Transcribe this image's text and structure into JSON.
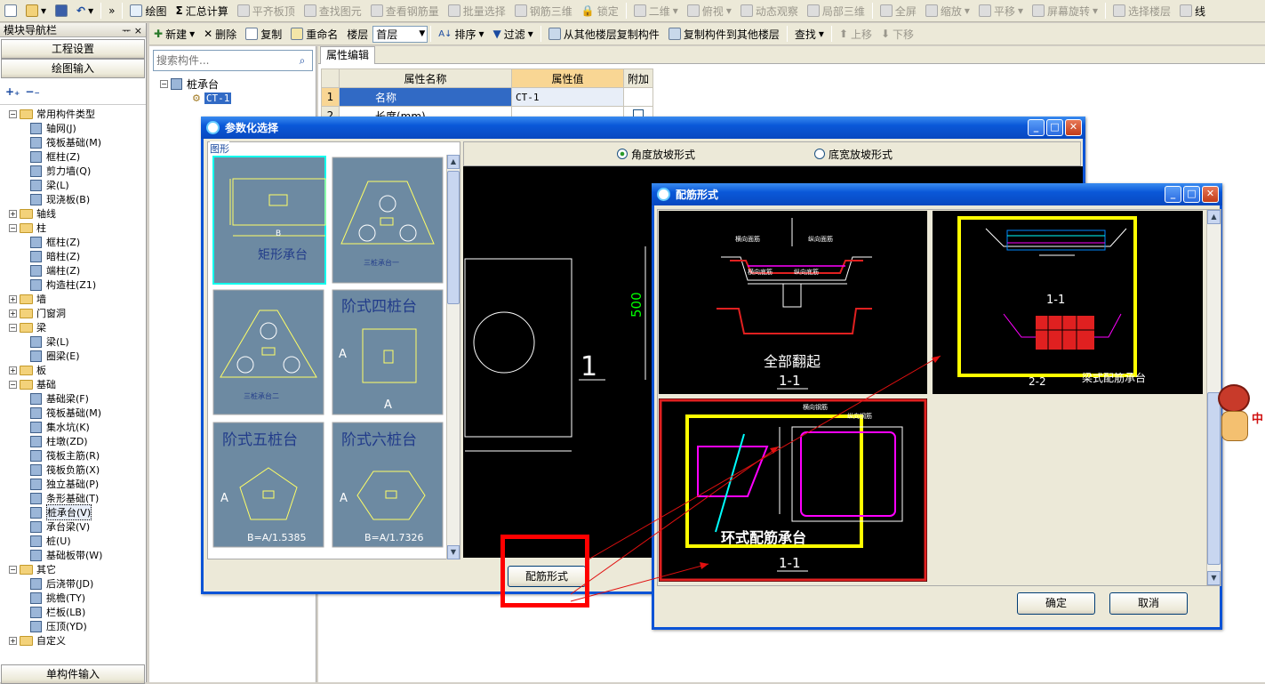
{
  "toolbar1": {
    "items": [
      "绘图",
      "汇总计算",
      "平齐板顶",
      "查找图元",
      "查看钢筋量",
      "批量选择",
      "钢筋三维",
      "锁定",
      "二维",
      "俯视",
      "动态观察",
      "局部三维",
      "全屏",
      "缩放",
      "平移",
      "屏幕旋转",
      "选择楼层",
      "线"
    ]
  },
  "toolbar2": {
    "new": "新建",
    "delete": "删除",
    "copy": "复制",
    "rename": "重命名",
    "floor_label": "楼层",
    "floor_value": "首层",
    "sort": "排序",
    "filter": "过滤",
    "copy_from": "从其他楼层复制构件",
    "copy_to": "复制构件到其他楼层",
    "find": "查找",
    "up": "上移",
    "down": "下移"
  },
  "nav": {
    "title": "模块导航栏",
    "pin": "ᅲ ×",
    "project_settings": "工程设置",
    "drawing_input": "绘图输入",
    "single_input": "单构件输入",
    "tree": [
      {
        "label": "常用构件类型",
        "level": 0,
        "type": "folder",
        "expanded": true
      },
      {
        "label": "轴网(J)",
        "level": 1
      },
      {
        "label": "筏板基础(M)",
        "level": 1
      },
      {
        "label": "框柱(Z)",
        "level": 1
      },
      {
        "label": "剪力墙(Q)",
        "level": 1
      },
      {
        "label": "梁(L)",
        "level": 1
      },
      {
        "label": "现浇板(B)",
        "level": 1
      },
      {
        "label": "轴线",
        "level": 0,
        "type": "folder",
        "expanded": false
      },
      {
        "label": "柱",
        "level": 0,
        "type": "folder",
        "expanded": true
      },
      {
        "label": "框柱(Z)",
        "level": 1
      },
      {
        "label": "暗柱(Z)",
        "level": 1
      },
      {
        "label": "端柱(Z)",
        "level": 1
      },
      {
        "label": "构造柱(Z1)",
        "level": 1
      },
      {
        "label": "墙",
        "level": 0,
        "type": "folder",
        "expanded": false
      },
      {
        "label": "门窗洞",
        "level": 0,
        "type": "folder",
        "expanded": false
      },
      {
        "label": "梁",
        "level": 0,
        "type": "folder",
        "expanded": true
      },
      {
        "label": "梁(L)",
        "level": 1
      },
      {
        "label": "圈梁(E)",
        "level": 1
      },
      {
        "label": "板",
        "level": 0,
        "type": "folder",
        "expanded": false
      },
      {
        "label": "基础",
        "level": 0,
        "type": "folder",
        "expanded": true
      },
      {
        "label": "基础梁(F)",
        "level": 1
      },
      {
        "label": "筏板基础(M)",
        "level": 1
      },
      {
        "label": "集水坑(K)",
        "level": 1
      },
      {
        "label": "柱墩(ZD)",
        "level": 1
      },
      {
        "label": "筏板主筋(R)",
        "level": 1
      },
      {
        "label": "筏板负筋(X)",
        "level": 1
      },
      {
        "label": "独立基础(P)",
        "level": 1
      },
      {
        "label": "条形基础(T)",
        "level": 1
      },
      {
        "label": "桩承台(V)",
        "level": 1,
        "selected": true
      },
      {
        "label": "承台梁(V)",
        "level": 1
      },
      {
        "label": "桩(U)",
        "level": 1
      },
      {
        "label": "基础板带(W)",
        "level": 1
      },
      {
        "label": "其它",
        "level": 0,
        "type": "folder",
        "expanded": true
      },
      {
        "label": "后浇带(JD)",
        "level": 1
      },
      {
        "label": "挑檐(TY)",
        "level": 1
      },
      {
        "label": "栏板(LB)",
        "level": 1
      },
      {
        "label": "压顶(YD)",
        "level": 1
      },
      {
        "label": "自定义",
        "level": 0,
        "type": "folder",
        "expanded": false
      }
    ]
  },
  "component_list": {
    "search_placeholder": "搜索构件...",
    "root": "桩承台",
    "child": "CT-1"
  },
  "property": {
    "tab": "属性编辑",
    "headers": [
      "属性名称",
      "属性值",
      "附加"
    ],
    "rows": [
      {
        "no": "1",
        "name": "名称",
        "value": "CT-1"
      },
      {
        "no": "2",
        "name": "长度(mm)",
        "value": ""
      }
    ]
  },
  "param_dialog": {
    "title": "参数化选择",
    "group": "图形",
    "thumbs": [
      "矩形承台",
      "三桩承台一",
      "三桩承台二",
      "阶式四桩台",
      "阶式五桩台",
      "阶式六桩台"
    ],
    "formula5": "B=A/1.5385",
    "formula6": "B=A/1.7326",
    "radio1": "角度放坡形式",
    "radio2": "底宽放坡形式",
    "dim_500": "500",
    "label_1": "1",
    "button": "配筋形式"
  },
  "rebar_dialog": {
    "title": "配筋形式",
    "cell1_title": "全部翻起",
    "cell1_sec": "1-1",
    "cell2_sec": "1-1",
    "cell2_sub": "2-2",
    "cell2_title": "梁式配筋承台",
    "cell3_title": "环式配筋承台",
    "cell3_sec": "1-1",
    "cell1_labels": [
      "横向面筋",
      "纵向面筋",
      "横向底筋",
      "纵向底筋"
    ],
    "cell3_labels": [
      "横向钢筋",
      "纵向钢筋"
    ],
    "ok": "确定",
    "cancel": "取消"
  },
  "mascot_text": "中",
  "colors": {
    "accent": "#0a53d6",
    "highlight_red": "#ff0000",
    "highlight_yellow": "#ffff00",
    "drawing_bg": "#000000",
    "selection": "#316ac5"
  }
}
